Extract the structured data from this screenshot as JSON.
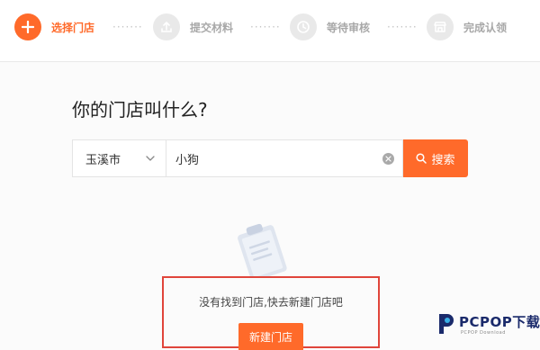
{
  "steps": [
    {
      "label": "选择门店",
      "icon": "plus-icon",
      "state": "active"
    },
    {
      "label": "提交材料",
      "icon": "upload-icon",
      "state": "inactive"
    },
    {
      "label": "等待审核",
      "icon": "clock-icon",
      "state": "inactive"
    },
    {
      "label": "完成认领",
      "icon": "store-icon",
      "state": "inactive"
    }
  ],
  "step_separator": "·······",
  "page_title": "你的门店叫什么?",
  "search": {
    "city": "玉溪市",
    "query": "小狗",
    "button_label": "搜索"
  },
  "empty_state": {
    "message": "没有找到门店,快去新建门店吧",
    "button_label": "新建门店"
  },
  "watermark": {
    "brand": "PCPOP下载",
    "tagline": "PCPOP Download"
  },
  "colors": {
    "accent": "#ff6a2a",
    "highlight_border": "#e0453b",
    "inactive_step": "#e9e9e9"
  }
}
